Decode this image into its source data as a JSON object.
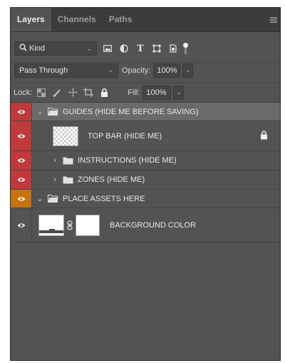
{
  "tabs": [
    {
      "label": "Layers",
      "active": true
    },
    {
      "label": "Channels",
      "active": false
    },
    {
      "label": "Paths",
      "active": false
    }
  ],
  "filter": {
    "kind_label": "Kind",
    "icons": [
      "image-filter-icon",
      "adjustment-filter-icon",
      "type-filter-icon",
      "shape-filter-icon",
      "smart-object-filter-icon"
    ],
    "type_glyph": "T"
  },
  "blend": {
    "mode": "Pass Through",
    "opacity_label": "Opacity:",
    "opacity_value": "100%"
  },
  "lock": {
    "label": "Lock:",
    "fill_label": "Fill:",
    "fill_value": "100%"
  },
  "colors": {
    "panel_bg": "#535353",
    "selected_row": "#6a6a6a",
    "vis_red": "#c0393b",
    "vis_orange": "#c7730f"
  },
  "layers": [
    {
      "name": "GUIDES (HIDE ME BEFORE SAVING)",
      "type": "group",
      "expanded": true,
      "selected": true,
      "color": "red"
    },
    {
      "name": "TOP BAR (HIDE ME)",
      "type": "layer",
      "color": "red",
      "locked": true
    },
    {
      "name": "INSTRUCTIONS (HIDE ME)",
      "type": "group",
      "expanded": false,
      "color": "red"
    },
    {
      "name": "ZONES (HIDE ME)",
      "type": "group",
      "expanded": false,
      "color": "red"
    },
    {
      "name": "PLACE ASSETS HERE",
      "type": "group",
      "expanded": true,
      "color": "orange"
    },
    {
      "name": "BACKGROUND COLOR",
      "type": "fill-layer",
      "color": "none"
    }
  ]
}
